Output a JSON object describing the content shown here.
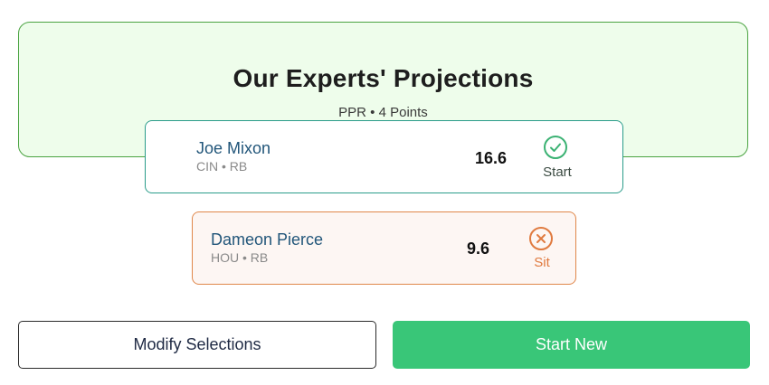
{
  "header": {
    "title": "Our Experts' Projections",
    "subtitle": "PPR • 4 Points"
  },
  "players": [
    {
      "name": "Joe Mixon",
      "meta": "CIN • RB",
      "points": "16.6",
      "verdict": "Start",
      "verdict_icon": "check-circle-icon",
      "accent": "#3bb273"
    },
    {
      "name": "Dameon Pierce",
      "meta": "HOU • RB",
      "points": "9.6",
      "verdict": "Sit",
      "verdict_icon": "x-circle-icon",
      "accent": "#e07a3f"
    }
  ],
  "actions": {
    "modify_label": "Modify Selections",
    "start_new_label": "Start New"
  },
  "colors": {
    "header_bg": "#eefdeb",
    "header_border": "#4aa341",
    "primary_button": "#39c678"
  }
}
